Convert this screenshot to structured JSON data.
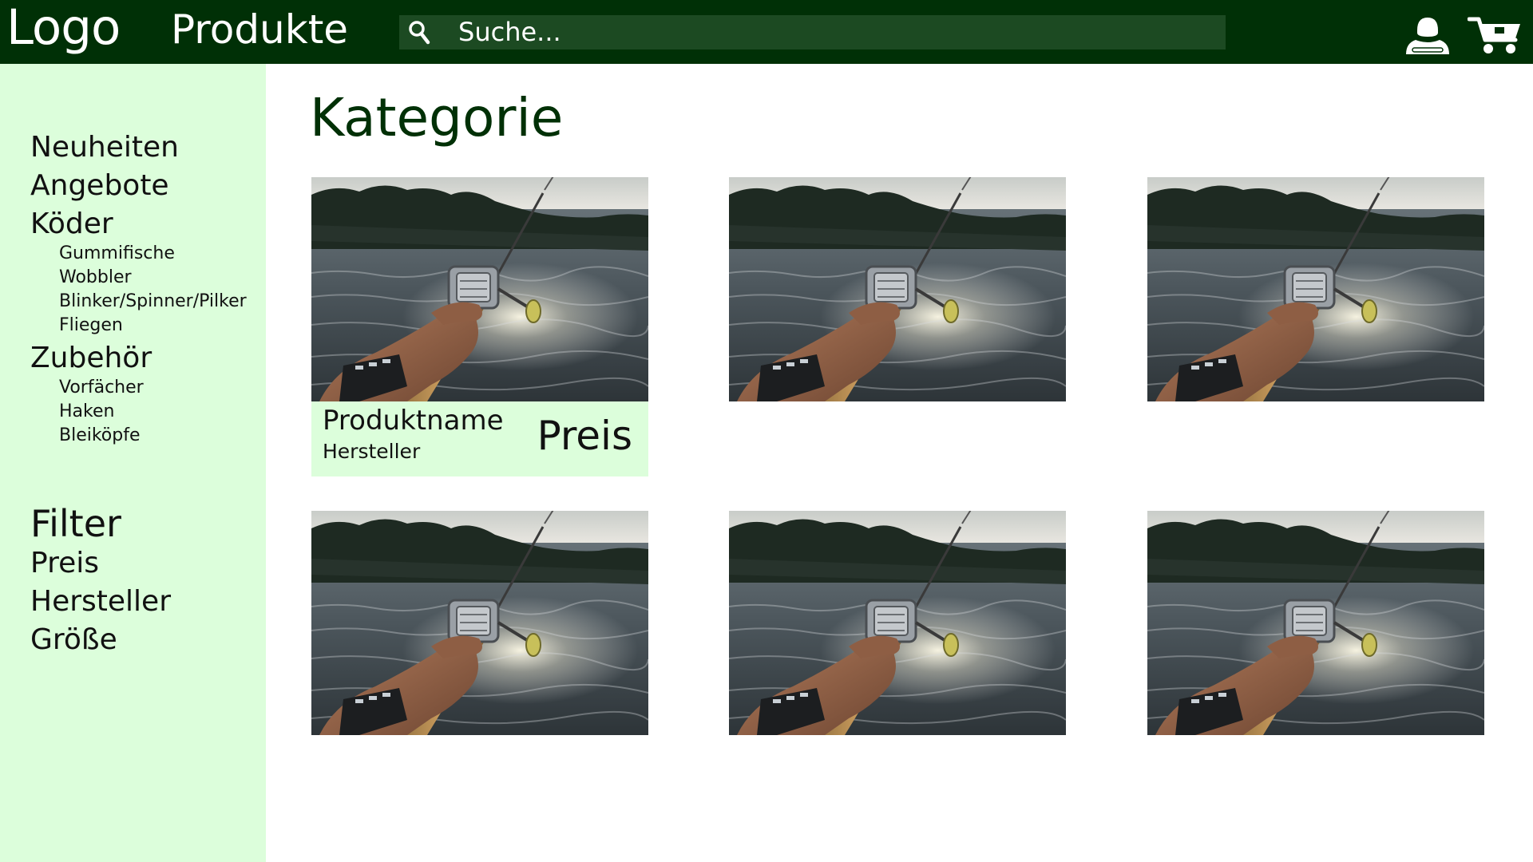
{
  "header": {
    "logo": "Logo",
    "nav_products": "Produkte",
    "search": {
      "placeholder": "Suche..."
    },
    "icons": {
      "search": "search-icon",
      "user": "user-icon",
      "cart": "cart-icon"
    }
  },
  "sidebar": {
    "categories": {
      "neuheiten": "Neuheiten",
      "angebote": "Angebote",
      "koeder": {
        "label": "Köder",
        "sub": [
          "Gummifische",
          "Wobbler",
          "Blinker/Spinner/Pilker",
          "Fliegen"
        ]
      },
      "zubehoer": {
        "label": "Zubehör",
        "sub": [
          "Vorfächer",
          "Haken",
          "Bleiköpfe"
        ]
      }
    },
    "filter": {
      "heading": "Filter",
      "items": [
        "Preis",
        "Hersteller",
        "Größe"
      ]
    }
  },
  "main": {
    "title": "Kategorie",
    "products": [
      {
        "image": "fishing-reel-photo",
        "name": "Produktname",
        "maker": "Hersteller",
        "price": "Preis"
      },
      {
        "image": "fishing-reel-photo"
      },
      {
        "image": "fishing-reel-photo"
      },
      {
        "image": "fishing-reel-photo"
      },
      {
        "image": "fishing-reel-photo"
      },
      {
        "image": "fishing-reel-photo"
      }
    ]
  },
  "colors": {
    "header_bg": "#003006",
    "search_bg": "#1c4a22",
    "sidebar_bg": "#dcfedb",
    "title": "#003006"
  }
}
